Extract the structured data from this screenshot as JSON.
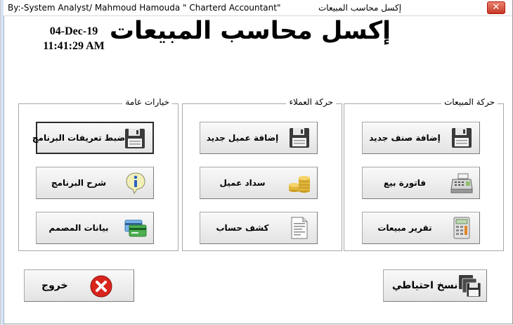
{
  "window": {
    "credit": "By:-System Analyst/ Mahmoud Hamouda  \" Charterd Accountant\"",
    "title": "إكسل محاسب المبيعات",
    "close_label": "✕"
  },
  "header": {
    "date": "04-Dec-19",
    "time": "11:41:29 AM",
    "title": "إكسل محاسب المبيعات"
  },
  "groups": {
    "general": {
      "title": "خيارات عامة",
      "buttons": [
        {
          "label": "ضبط تعريفات البرنامج",
          "icon": "floppy-disk-icon"
        },
        {
          "label": "شرح البرنامج",
          "icon": "info-icon"
        },
        {
          "label": "بيانات المصمم",
          "icon": "credit-cards-icon"
        }
      ]
    },
    "customers": {
      "title": "حركة العملاء",
      "buttons": [
        {
          "label": "إضافة عميل جديد",
          "icon": "floppy-disk-icon"
        },
        {
          "label": "سداد عميل",
          "icon": "gold-coins-icon"
        },
        {
          "label": "كشف حساب",
          "icon": "document-icon"
        }
      ]
    },
    "sales": {
      "title": "حركة المبيعات",
      "buttons": [
        {
          "label": "إضافة صنف جديد",
          "icon": "floppy-disk-icon"
        },
        {
          "label": "فاتورة بيع",
          "icon": "cash-register-icon"
        },
        {
          "label": "تقرير مبيعات",
          "icon": "calculator-icon"
        }
      ]
    }
  },
  "footer": {
    "exit_label": "خروج",
    "backup_label": "نسخ احتياطي"
  },
  "colors": {
    "close_button": "#c63a24",
    "exit_icon": "#d9251d",
    "info_icon": "#2a62c4"
  }
}
